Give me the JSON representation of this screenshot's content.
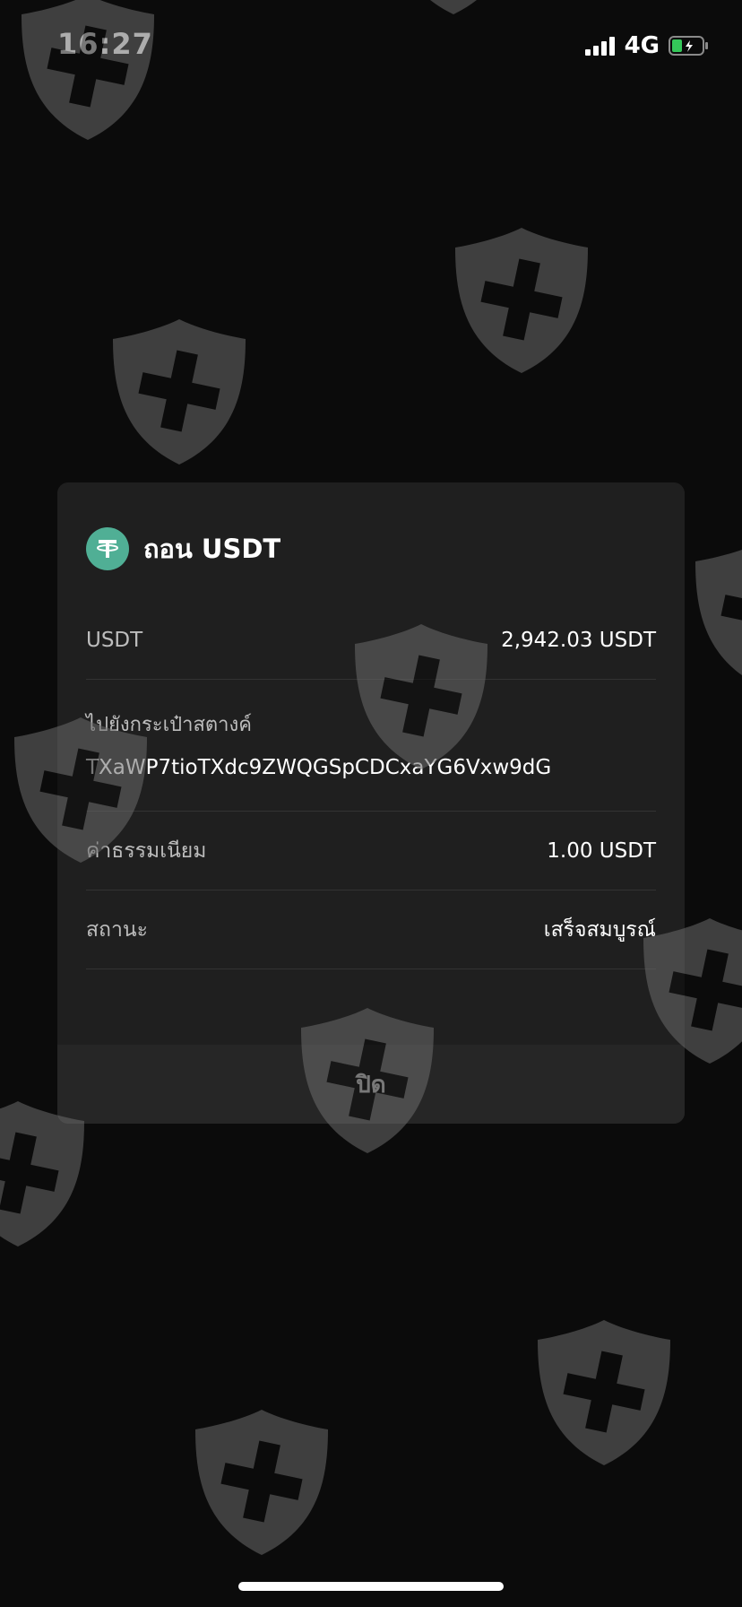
{
  "status_bar": {
    "time": "16:27",
    "network": "4G",
    "icons": [
      "signal-icon",
      "battery-icon"
    ],
    "battery_color": "#34c759"
  },
  "dialog": {
    "icon": "tether-icon",
    "icon_color": "#50af95",
    "title": "ถอน USDT",
    "rows": [
      {
        "label": "USDT",
        "value": "2,942.03 USDT"
      },
      {
        "label": "ไปยังกระเป๋าสตางค์",
        "value": "TXaWP7tioTXdc9ZWQGSpCDCxaYG6Vxw9dG"
      },
      {
        "label": "ค่าธรรมเนียม",
        "value": "1.00 USDT"
      },
      {
        "label": "สถานะ",
        "value": "เสร็จสมบูรณ์"
      }
    ],
    "close_label": "ปิด"
  },
  "watermark": {
    "icon": "shield-plus-icon",
    "color": "#6b6b6b"
  }
}
